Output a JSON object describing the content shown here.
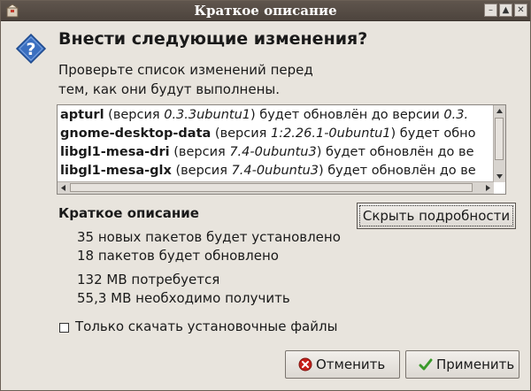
{
  "window": {
    "title": "Краткое описание"
  },
  "dialog": {
    "heading": "Внести следующие изменения?",
    "subtext_line1": "Проверьте список изменений перед",
    "subtext_line2": "тем, как они будут выполнены."
  },
  "changes": [
    {
      "pkg": "apturl",
      "mid1": " (версия ",
      "from": "0.3.3ubuntu1",
      "mid2": ") будет обновлён до версии ",
      "to": "0.3."
    },
    {
      "pkg": "gnome-desktop-data",
      "mid1": " (версия ",
      "from": "1:2.26.1-0ubuntu1",
      "mid2": ") будет обно",
      "to": ""
    },
    {
      "pkg": "libgl1-mesa-dri",
      "mid1": " (версия ",
      "from": "7.4-0ubuntu3",
      "mid2": ") будет обновлён до ве",
      "to": ""
    },
    {
      "pkg": "libgl1-mesa-glx",
      "mid1": " (версия ",
      "from": "7.4-0ubuntu3",
      "mid2": ") будет обновлён до ве",
      "to": ""
    }
  ],
  "summary": {
    "label": "Краткое описание",
    "hide_details": "Скрыть подробности",
    "new_packages": "35 новых пакетов будет установлено",
    "upgraded": "18 пакетов будет обновлено",
    "space_required": "132 MB потребуется",
    "download_size": "55,3 MB необходимо получить"
  },
  "options": {
    "download_only": "Только скачать установочные файлы",
    "download_only_checked": false
  },
  "buttons": {
    "cancel": "Отменить",
    "apply": "Применить"
  },
  "icons": {
    "app": "package-icon",
    "dialog": "question-icon",
    "cancel": "cancel-icon",
    "apply": "checkmark-icon"
  },
  "colors": {
    "titlebar": "#5a5048",
    "window_bg": "#e8e4dd",
    "question_blue": "#3a6fc0",
    "cancel_red": "#c8201a",
    "apply_green": "#3a9a2a"
  }
}
